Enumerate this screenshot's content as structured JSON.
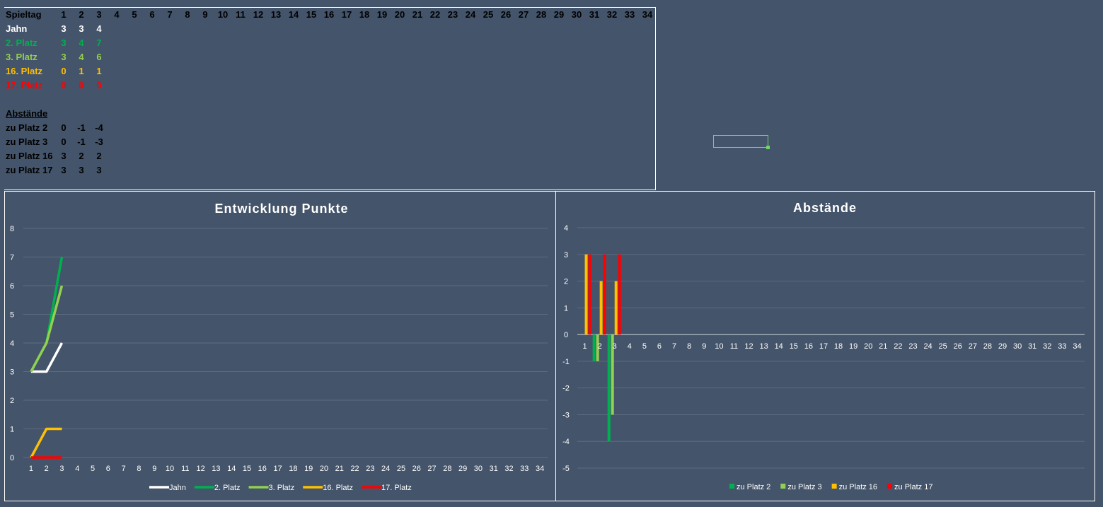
{
  "table": {
    "header_label": "Spieltag",
    "days": [
      "1",
      "2",
      "3",
      "4",
      "5",
      "6",
      "7",
      "8",
      "9",
      "10",
      "11",
      "12",
      "13",
      "14",
      "15",
      "16",
      "17",
      "18",
      "19",
      "20",
      "21",
      "22",
      "23",
      "24",
      "25",
      "26",
      "27",
      "28",
      "29",
      "30",
      "31",
      "32",
      "33",
      "34"
    ],
    "rows": [
      {
        "label": "Jahn",
        "values": [
          "3",
          "3",
          "4"
        ],
        "color": "#ffffff"
      },
      {
        "label": "2. Platz",
        "values": [
          "3",
          "4",
          "7"
        ],
        "color": "#00b050"
      },
      {
        "label": "3. Platz",
        "values": [
          "3",
          "4",
          "6"
        ],
        "color": "#92d050"
      },
      {
        "label": "16. Platz",
        "values": [
          "0",
          "1",
          "1"
        ],
        "color": "#ffc000"
      },
      {
        "label": "17. Platz",
        "values": [
          "0",
          "0",
          "0"
        ],
        "color": "#ff0000"
      }
    ],
    "section_label": "Abstände",
    "diff_rows": [
      {
        "label": "zu Platz 2",
        "values": [
          "0",
          "-1",
          "-4"
        ]
      },
      {
        "label": "zu Platz 3",
        "values": [
          "0",
          "-1",
          "-3"
        ]
      },
      {
        "label": "zu Platz 16",
        "values": [
          "3",
          "2",
          "2"
        ]
      },
      {
        "label": "zu Platz 17",
        "values": [
          "3",
          "3",
          "3"
        ]
      }
    ]
  },
  "chart_data": [
    {
      "type": "line",
      "title": "Entwicklung Punkte",
      "categories": [
        "1",
        "2",
        "3",
        "4",
        "5",
        "6",
        "7",
        "8",
        "9",
        "10",
        "11",
        "12",
        "13",
        "14",
        "15",
        "16",
        "17",
        "18",
        "19",
        "20",
        "21",
        "22",
        "23",
        "24",
        "25",
        "26",
        "27",
        "28",
        "29",
        "30",
        "31",
        "32",
        "33",
        "34"
      ],
      "ylim": [
        0,
        8
      ],
      "yticks": [
        "0",
        "1",
        "2",
        "3",
        "4",
        "5",
        "6",
        "7",
        "8"
      ],
      "grid": true,
      "legend": "bottom",
      "series": [
        {
          "name": "Jahn",
          "values": [
            3,
            3,
            4
          ],
          "color": "#ffffff"
        },
        {
          "name": "2. Platz",
          "values": [
            3,
            4,
            7
          ],
          "color": "#00b050"
        },
        {
          "name": "3. Platz",
          "values": [
            3,
            4,
            6
          ],
          "color": "#92d050"
        },
        {
          "name": "16. Platz",
          "values": [
            0,
            1,
            1
          ],
          "color": "#ffc000"
        },
        {
          "name": "17. Platz",
          "values": [
            0,
            0,
            0
          ],
          "color": "#ff0000"
        }
      ]
    },
    {
      "type": "bar",
      "title": "Abstände",
      "categories": [
        "1",
        "2",
        "3",
        "4",
        "5",
        "6",
        "7",
        "8",
        "9",
        "10",
        "11",
        "12",
        "13",
        "14",
        "15",
        "16",
        "17",
        "18",
        "19",
        "20",
        "21",
        "22",
        "23",
        "24",
        "25",
        "26",
        "27",
        "28",
        "29",
        "30",
        "31",
        "32",
        "33",
        "34"
      ],
      "ylim": [
        -5,
        4
      ],
      "yticks": [
        "-5",
        "-4",
        "-3",
        "-2",
        "-1",
        "0",
        "1",
        "2",
        "3",
        "4"
      ],
      "grid": true,
      "legend": "bottom",
      "series": [
        {
          "name": "zu Platz 2",
          "values": [
            0,
            -1,
            -4
          ],
          "color": "#00b050"
        },
        {
          "name": "zu Platz 3",
          "values": [
            0,
            -1,
            -3
          ],
          "color": "#92d050"
        },
        {
          "name": "zu Platz 16",
          "values": [
            3,
            2,
            2
          ],
          "color": "#ffc000"
        },
        {
          "name": "zu Platz 17",
          "values": [
            3,
            3,
            3
          ],
          "color": "#ff0000"
        }
      ]
    }
  ]
}
